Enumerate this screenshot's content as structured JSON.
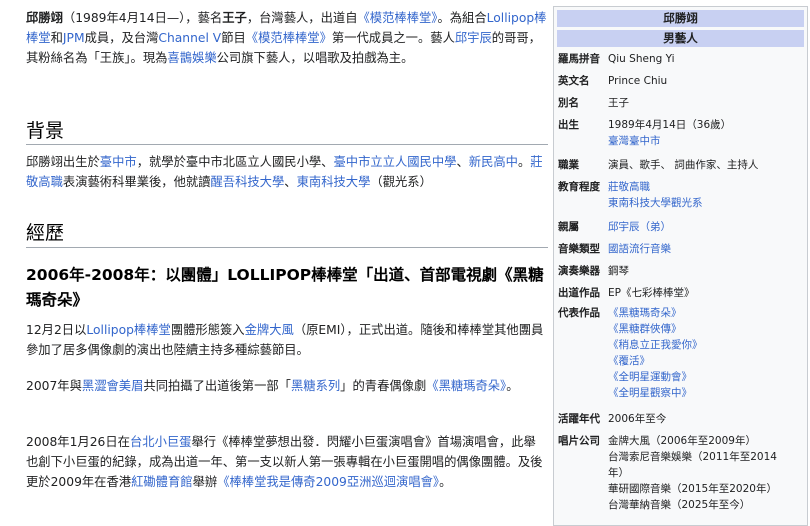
{
  "intro": {
    "name": "邱勝翊",
    "t1": "（1989年4月14日—），藝名",
    "stage_name": "王子",
    "t2": "，台灣藝人，出道自",
    "link_show": "《模范棒棒堂》",
    "t3": "。為組合",
    "link_lollipop": "Lollipop棒棒堂",
    "t4": "和",
    "link_jpm": "JPM",
    "t5": "成員，及台灣",
    "link_channelv": "Channel V",
    "t6": "節目",
    "link_show2": "《模范棒棒堂》",
    "t7": "第一代成員之一。藝人",
    "link_brother": "邱宇辰",
    "t8": "的哥哥，其粉絲名為「王族」。現為",
    "link_company": "喜鵲娛樂",
    "t9": "公司旗下藝人，以唱歌及拍戲為主。"
  },
  "background": {
    "heading": "背景",
    "t1": "邱勝翊出生於",
    "link_city": "臺中市",
    "t2": "，就學於臺中市北區立人國民小學、",
    "link_school1": "臺中市立立人國民中學",
    "t3": "、",
    "link_school2": "新民高中",
    "t4": "。",
    "link_school3": "莊敬高職",
    "t5": "表演藝術科畢業後，他就讀",
    "link_univ1": "醒吾科技大學",
    "t6": "、",
    "link_univ2": "東南科技大學",
    "t7": "（觀光系）"
  },
  "career": {
    "heading": "經歷",
    "subheading": "2006年-2008年：以團體」LOLLIPOP棒棒堂「出道、首部電視劇《黑糖瑪奇朵》",
    "p1_t1": "12月2日以",
    "p1_link1": "Lollipop棒棒堂",
    "p1_t2": "團體形態簽入",
    "p1_link2": "金牌大風",
    "p1_t3": "（原EMI），正式出道。隨後和棒棒堂其他團員參加了居多偶像劇的演出也陸續主持多種綜藝節目。",
    "p2_t1": "2007年與",
    "p2_link1": "黑澀會美眉",
    "p2_t2": "共同拍攝了出道後第一部「",
    "p2_link2": "黑糖系列",
    "p2_t3": "」的青春偶像劇",
    "p2_link3": "《黑糖瑪奇朵》",
    "p2_t4": "。",
    "p3_t1": "2008年1月26日在",
    "p3_link1": "台北小巨蛋",
    "p3_t2": "舉行《棒棒堂夢想出發．閃耀小巨蛋演唱會》首場演唱會，此舉也創下小巨蛋的紀錄，成為出道一年、第一支以新人第一張專輯在小巨蛋開唱的偶像團體。及後更於2009年在香港",
    "p3_link2": "紅磡體育館",
    "p3_t3": "舉辦",
    "p3_link3": "《棒棒堂我是傳奇2009亞洲巡迴演唱會》",
    "p3_t4": "。"
  },
  "infobox": {
    "title": "邱勝翊",
    "subtitle": "男藝人",
    "rows": [
      {
        "label": "羅馬拼音",
        "lines": [
          "Qiu Sheng Yi"
        ]
      },
      {
        "label": "英文名",
        "lines": [
          "Prince Chiu"
        ]
      },
      {
        "label": "別名",
        "lines": [
          "王子"
        ]
      },
      {
        "label": "出生",
        "lines": [
          "1989年4月14日（36歲）",
          "臺灣臺中市"
        ]
      },
      {
        "label": "職業",
        "lines": [
          "演員、歌手、 詞曲作家、主持人"
        ]
      },
      {
        "label": "教育程度",
        "lines": [
          "莊敬高職",
          "東南科技大學觀光系"
        ]
      },
      {
        "label": "親屬",
        "lines": [
          "邱宇辰（弟）"
        ]
      },
      {
        "label": "音樂類型",
        "lines": [
          "國語流行音樂"
        ]
      },
      {
        "label": "演奏樂器",
        "lines": [
          "鋼琴"
        ]
      },
      {
        "label": "出道作品",
        "lines": [
          "EP《七彩棒棒堂》"
        ]
      },
      {
        "label": "代表作品",
        "lines": [
          "《黑糖瑪奇朵》",
          "《黑糖群俠傳》",
          "《稍息立正我愛你》",
          "《覆活》",
          "《全明星運動會》",
          "《全明星觀察中》"
        ]
      },
      {
        "label": "活躍年代",
        "lines": [
          "2006年至今"
        ]
      },
      {
        "label": "唱片公司",
        "lines": [
          "金牌大風（2006年至2009年）",
          "台灣索尼音樂娛樂（2011年至2014",
          "年）",
          "華研國際音樂（2015年至2020年）",
          "台灣華納音樂（2025年至今）"
        ]
      }
    ]
  }
}
